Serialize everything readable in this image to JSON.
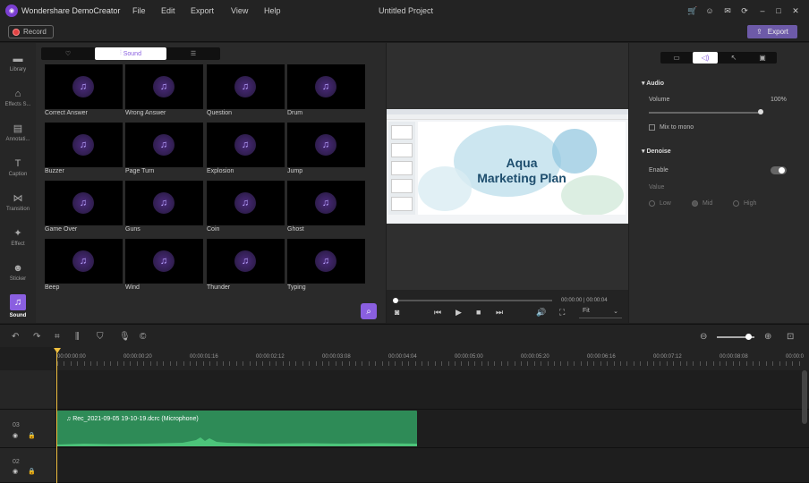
{
  "app": {
    "name": "Wondershare DemoCreator",
    "window_title": "Untitled Project"
  },
  "menu": [
    "File",
    "Edit",
    "Export",
    "View",
    "Help"
  ],
  "toolbar": {
    "record_label": "Record",
    "export_label": "Export"
  },
  "sidebar": {
    "items": [
      {
        "label": "Library",
        "icon": "folder-icon"
      },
      {
        "label": "Effects S...",
        "icon": "effects-icon"
      },
      {
        "label": "Annotati...",
        "icon": "annotation-icon"
      },
      {
        "label": "Caption",
        "icon": "caption-icon"
      },
      {
        "label": "Transition",
        "icon": "transition-icon"
      },
      {
        "label": "Effect",
        "icon": "effect-wand-icon"
      },
      {
        "label": "Sticker",
        "icon": "sticker-icon"
      },
      {
        "label": "Sound",
        "icon": "sound-icon",
        "active": true
      }
    ]
  },
  "library": {
    "tabs": [
      {
        "label": "",
        "icon": "heart-icon"
      },
      {
        "label": "Sound",
        "icon": "waveform-icon",
        "active": true
      },
      {
        "label": "",
        "icon": "list-icon"
      }
    ],
    "items": [
      "Correct Answer",
      "Wrong Answer",
      "Question",
      "Drum",
      "Buzzer",
      "Page Turn",
      "Explosion",
      "Jump",
      "Game Over",
      "Guns",
      "Coin",
      "Ghost",
      "Beep",
      "Wind",
      "Thunder",
      "Typing"
    ]
  },
  "preview": {
    "slide_title_line1": "Aqua",
    "slide_title_line2": "Marketing Plan",
    "time": "00:00:00 | 00:00:04",
    "fit": "Fit",
    "progress": 0
  },
  "properties": {
    "audio_section": "Audio",
    "volume_label": "Volume",
    "volume_value": "100%",
    "mix_to_mono": "Mix to mono",
    "denoise_section": "Denoise",
    "enable_label": "Enable",
    "value_label": "Value",
    "levels": [
      "Low",
      "Mid",
      "High"
    ]
  },
  "timeline": {
    "ruler_labels": [
      "00:00:00:00",
      "00:00:00:20",
      "00:00:01:16",
      "00:00:02:12",
      "00:00:03:08",
      "00:00:04:04",
      "00:00:05:00",
      "00:00:05:20",
      "00:00:06:16",
      "00:00:07:12",
      "00:00:08:08",
      "00:00:0"
    ],
    "tracks": [
      {
        "number": "03"
      },
      {
        "number": "02"
      }
    ],
    "clip_label": "Rec_2021-09-05 19-10-19.dcrc (Microphone)"
  },
  "colors": {
    "accent": "#8a5fe0",
    "clip": "#2e8b57",
    "playhead": "#f0c040",
    "export": "#6d5aa8"
  }
}
